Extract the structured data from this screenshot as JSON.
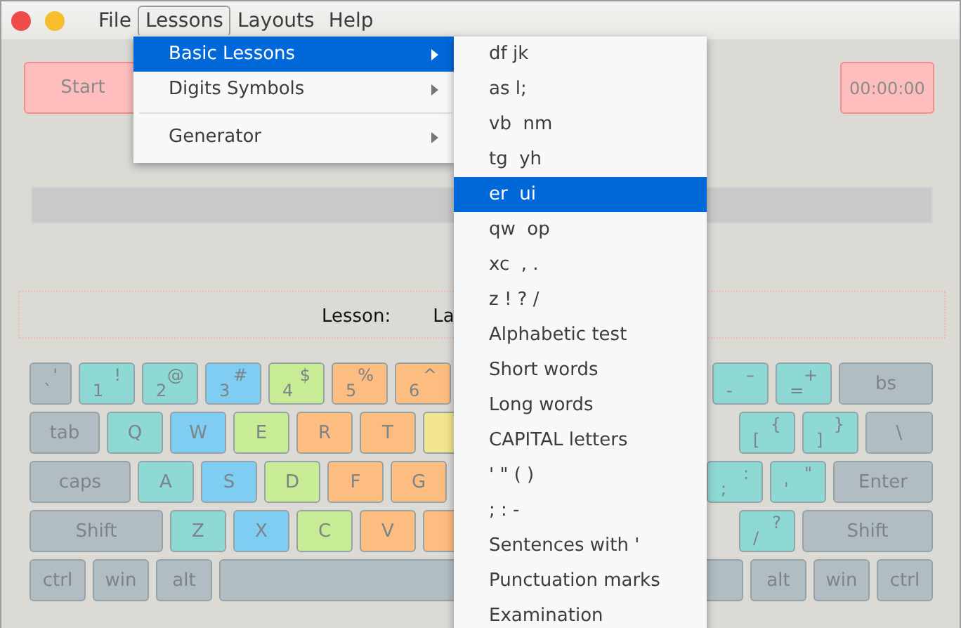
{
  "menubar": [
    {
      "label": "File",
      "selected": false
    },
    {
      "label": "Lessons",
      "selected": true
    },
    {
      "label": "Layouts",
      "selected": false
    },
    {
      "label": "Help",
      "selected": false
    }
  ],
  "lessons_menu": [
    {
      "kind": "item",
      "label": "Basic Lessons",
      "selected": true
    },
    {
      "kind": "item",
      "label": "Digits Symbols",
      "selected": false
    },
    {
      "kind": "separator"
    },
    {
      "kind": "item",
      "label": "Generator",
      "selected": false
    }
  ],
  "basic_lessons_menu": [
    {
      "label": "df jk",
      "selected": false
    },
    {
      "label": "as l;",
      "selected": false
    },
    {
      "label": "vb  nm",
      "selected": false
    },
    {
      "label": "tg  yh",
      "selected": false
    },
    {
      "label": "er  ui",
      "selected": true
    },
    {
      "label": "qw  op",
      "selected": false
    },
    {
      "label": "xc  , .",
      "selected": false
    },
    {
      "label": "z ! ? /",
      "selected": false
    },
    {
      "label": "Alphabetic test",
      "selected": false
    },
    {
      "label": "Short words",
      "selected": false
    },
    {
      "label": "Long words",
      "selected": false
    },
    {
      "label": "CAPITAL letters",
      "selected": false
    },
    {
      "label": "' \" ( )",
      "selected": false
    },
    {
      "label": "; : -",
      "selected": false
    },
    {
      "label": "Sentences with '",
      "selected": false
    },
    {
      "label": "Punctuation marks",
      "selected": false
    },
    {
      "label": "Examination",
      "selected": false
    }
  ],
  "start_button": "Start",
  "timer": "00:00:00",
  "progress": {
    "level": 0
  },
  "lesson_label": "Lesson:",
  "layout_label": "La",
  "keyboard": [
    {
      "left": [
        {
          "kind": "backtick",
          "label": "`",
          "shift": "'",
          "color": "#b1bdc2"
        },
        {
          "kind": "char",
          "label": "1",
          "shift": "!",
          "color": "#8fd9d5"
        },
        {
          "kind": "char",
          "label": "2",
          "shift": "@",
          "color": "#8fd9d5"
        },
        {
          "kind": "char",
          "label": "3",
          "shift": "#",
          "color": "#80cdf4"
        },
        {
          "kind": "char",
          "label": "4",
          "shift": "$",
          "color": "#c8ec95"
        },
        {
          "kind": "char",
          "label": "5",
          "shift": "%",
          "color": "#fdbc80"
        },
        {
          "kind": "char",
          "label": "6",
          "shift": "^",
          "color": "#fdbc80"
        }
      ],
      "right": [
        {
          "kind": "char",
          "label": "-",
          "shift": "–",
          "color": "#8fd9d5"
        },
        {
          "kind": "char",
          "label": "=",
          "shift": "+",
          "color": "#8fd9d5"
        },
        {
          "kind": "backspace",
          "label": "bs",
          "color": "#b1bdc2"
        }
      ]
    },
    {
      "left": [
        {
          "kind": "tab",
          "label": "tab",
          "color": "#b1bdc2"
        },
        {
          "kind": "char",
          "label": "Q",
          "color": "#8fd9d5"
        },
        {
          "kind": "char",
          "label": "W",
          "color": "#80cdf4"
        },
        {
          "kind": "char",
          "label": "E",
          "color": "#c8ec95"
        },
        {
          "kind": "char",
          "label": "R",
          "color": "#fdbc80"
        },
        {
          "kind": "char",
          "label": "T",
          "color": "#fdbc80"
        },
        {
          "kind": "char",
          "color": "#f4e48e"
        }
      ],
      "right": [
        {
          "kind": "char",
          "label": "[",
          "shift": "{",
          "color": "#8fd9d5"
        },
        {
          "kind": "char",
          "label": "]",
          "shift": "}",
          "color": "#8fd9d5"
        },
        {
          "kind": "backslash",
          "label": "\\",
          "color": "#b1bdc2"
        }
      ]
    },
    {
      "left": [
        {
          "kind": "caps",
          "label": "caps",
          "color": "#b1bdc2"
        },
        {
          "kind": "char",
          "label": "A",
          "color": "#8fd9d5"
        },
        {
          "kind": "char",
          "label": "S",
          "color": "#80cdf4"
        },
        {
          "kind": "char",
          "label": "D",
          "color": "#c8ec95"
        },
        {
          "kind": "char",
          "label": "F",
          "color": "#fdbc80"
        },
        {
          "kind": "char",
          "label": "G",
          "color": "#fdbc80"
        }
      ],
      "right": [
        {
          "kind": "char",
          "label": ";",
          "shift": ":",
          "color": "#8fd9d5"
        },
        {
          "kind": "char",
          "label": "'",
          "shift": "\"",
          "color": "#8fd9d5"
        },
        {
          "kind": "enter",
          "label": "Enter",
          "color": "#b1bdc2"
        }
      ]
    },
    {
      "left": [
        {
          "kind": "shift",
          "label": "Shift",
          "color": "#b1bdc2"
        },
        {
          "kind": "char",
          "label": "Z",
          "color": "#8fd9d5"
        },
        {
          "kind": "char",
          "label": "X",
          "color": "#80cdf4"
        },
        {
          "kind": "char",
          "label": "C",
          "color": "#c8ec95"
        },
        {
          "kind": "char",
          "label": "V",
          "color": "#fdbc80"
        },
        {
          "kind": "char",
          "color": "#fdbc80"
        }
      ],
      "right": [
        {
          "kind": "char",
          "label": "/",
          "shift": "?",
          "color": "#8fd9d5"
        },
        {
          "kind": "rshift",
          "label": "Shift",
          "color": "#b1bdc2"
        }
      ]
    },
    {
      "left": [
        {
          "kind": "mod",
          "label": "ctrl",
          "color": "#b1bdc2"
        },
        {
          "kind": "mod",
          "label": "win",
          "color": "#b1bdc2"
        },
        {
          "kind": "mod",
          "label": "alt",
          "color": "#b1bdc2"
        },
        {
          "kind": "space",
          "color": "#b1bdc2"
        }
      ],
      "right": [
        {
          "kind": "mod",
          "label": "alt",
          "color": "#b1bdc2"
        },
        {
          "kind": "mod",
          "label": "win",
          "color": "#b1bdc2"
        },
        {
          "kind": "mod",
          "label": "ctrl",
          "color": "#b1bdc2"
        }
      ]
    }
  ]
}
